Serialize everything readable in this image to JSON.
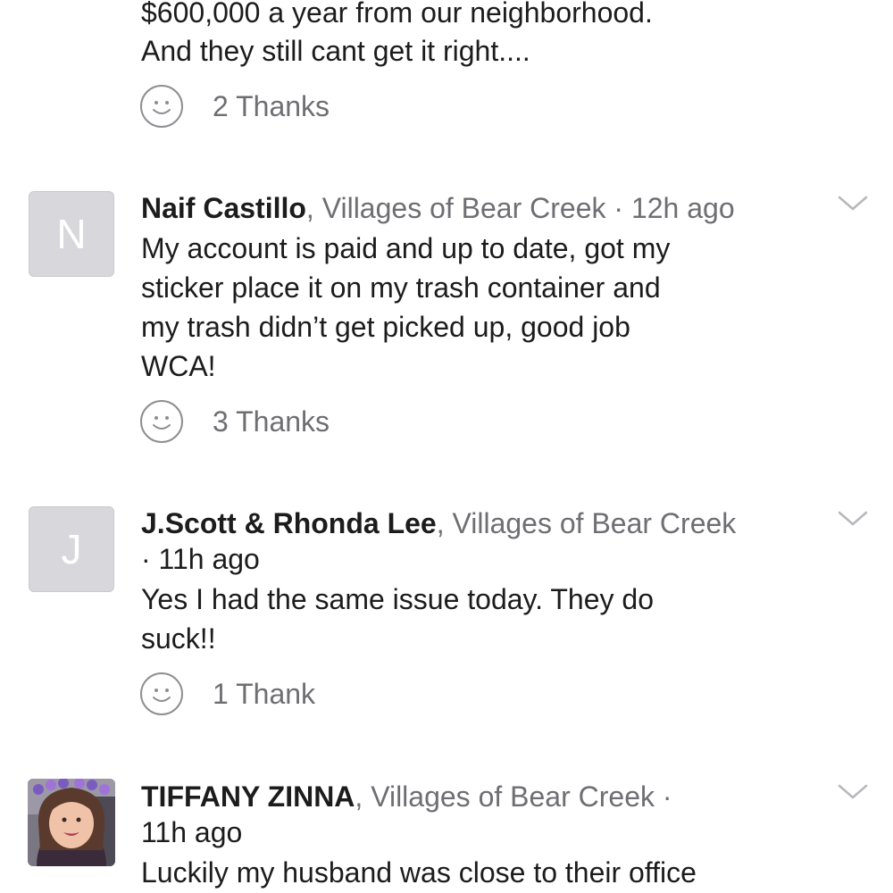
{
  "posts": [
    {
      "body_lines": [
        "$600,000 a year from our neighborhood.",
        "And they still cant get it right...."
      ],
      "thanks": "2 Thanks"
    },
    {
      "avatar_letter": "N",
      "author": "Naif Castillo",
      "separator": ",",
      "neighborhood": "Villages of Bear Creek",
      "time": "· 12h ago",
      "body_lines": [
        "My account is paid and up to date, got my",
        "sticker place it on my trash container and",
        "my trash didn’t get picked up, good job",
        "WCA!"
      ],
      "thanks": "3 Thanks"
    },
    {
      "avatar_letter": "J",
      "author": "J.Scott & Rhonda Lee",
      "separator": ",",
      "neighborhood": "Villages of Bear Creek",
      "time": "· 11h ago",
      "body_lines": [
        "Yes I had the same issue today. They do",
        "suck!!"
      ],
      "thanks": "1 Thank"
    },
    {
      "author": "TIFFANY ZINNA",
      "separator": ",",
      "neighborhood": "Villages of Bear Creek ·",
      "time": "11h ago",
      "body_lines": [
        "Luckily my husband was close to their office"
      ]
    }
  ],
  "icons": {
    "reaction": "smiley-face-icon",
    "more": "chevron-down-icon"
  },
  "colors": {
    "text": "#1c1c1c",
    "muted": "#6e6e73",
    "placeholder_avatar": "#d8d8dc"
  }
}
